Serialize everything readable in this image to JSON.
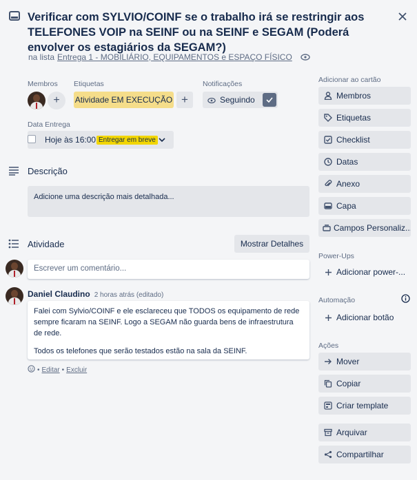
{
  "card": {
    "title": "Verificar com SYLVIO/COINF se o trabalho irá se restringir aos TELEFONES VOIP na SEINF ou na SEINF e SEGAM (Poderá envolver os estagiários da SEGAM?)",
    "list_prefix": "na lista",
    "list_name": "Entrega 1 - MOBILIÁRIO, EQUIPAMENTOS e ESPAÇO FÍSICO"
  },
  "members": {
    "label": "Membros",
    "add": "+"
  },
  "labels": {
    "label": "Etiquetas",
    "chip": "Atividade EM EXECUÇÃO",
    "chip_color": "#f5dd8a",
    "add": "+"
  },
  "notifications": {
    "label": "Notificações",
    "button": "Seguindo"
  },
  "due": {
    "label": "Data Entrega",
    "value": "Hoje às 16:00",
    "badge": "Entregar em breve",
    "badge_color": "#f2d600"
  },
  "description": {
    "heading": "Descrição",
    "placeholder": "Adicione uma descrição mais detalhada..."
  },
  "activity": {
    "heading": "Atividade",
    "show_details": "Mostrar Detalhes",
    "comment_placeholder": "Escrever um comentário...",
    "comment": {
      "author": "Daniel Claudino",
      "time": "2 horas atrás (editado)",
      "paragraphs": [
        "Falei com Sylvio/COINF e ele esclareceu que TODOS os equipamento de rede sempre ficaram na SEINF. Logo a SEGAM não guarda bens de infraestrutura de rede.",
        "Todos os telefones que serão testados estão na sala da SEINF."
      ],
      "edit": "Editar",
      "delete": "Excluir",
      "sep": "•"
    }
  },
  "sidebar": {
    "add_heading": "Adicionar ao cartão",
    "add_items": [
      {
        "label": "Membros",
        "icon": "person-icon"
      },
      {
        "label": "Etiquetas",
        "icon": "tag-icon"
      },
      {
        "label": "Checklist",
        "icon": "checkbox-icon"
      },
      {
        "label": "Datas",
        "icon": "clock-icon"
      },
      {
        "label": "Anexo",
        "icon": "paperclip-icon"
      },
      {
        "label": "Capa",
        "icon": "card-cover-icon"
      },
      {
        "label": "Campos Personaliz...",
        "icon": "custom-fields-icon"
      }
    ],
    "powerups_heading": "Power-Ups",
    "powerups_add": "Adicionar power-...",
    "automation_heading": "Automação",
    "automation_add": "Adicionar botão",
    "actions_heading": "Ações",
    "action_items": [
      {
        "label": "Mover",
        "icon": "arrow-right-icon"
      },
      {
        "label": "Copiar",
        "icon": "copy-icon"
      },
      {
        "label": "Criar template",
        "icon": "template-icon"
      },
      {
        "label": "Arquivar",
        "icon": "archive-icon"
      },
      {
        "label": "Compartilhar",
        "icon": "share-icon"
      }
    ]
  }
}
